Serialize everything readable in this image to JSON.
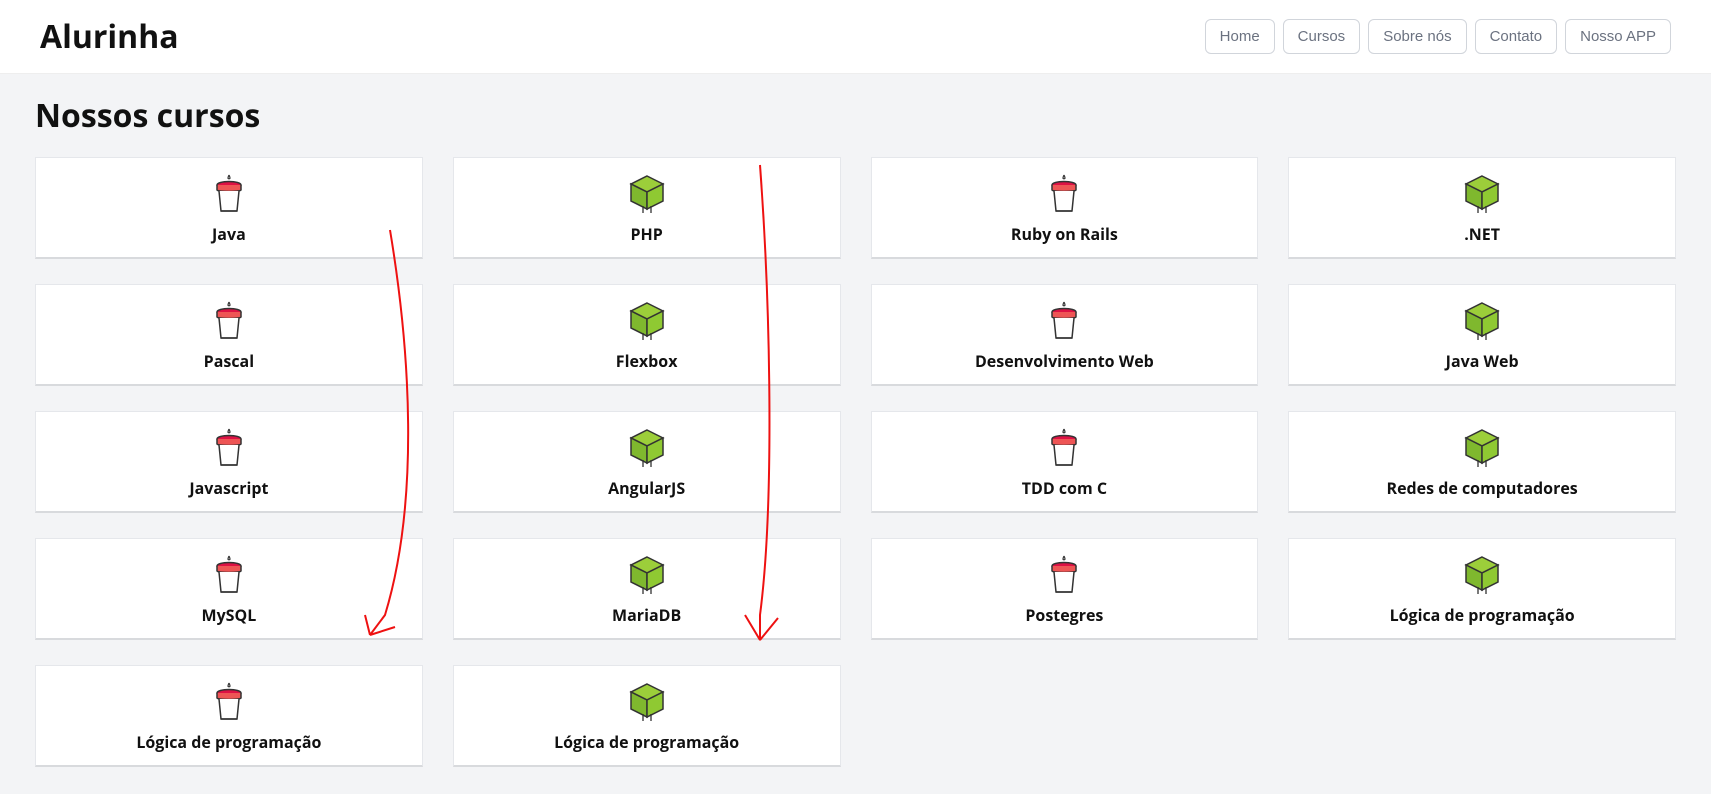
{
  "header": {
    "logo": "Alurinha",
    "nav": {
      "home": "Home",
      "cursos": "Cursos",
      "sobre": "Sobre nós",
      "contato": "Contato",
      "app": "Nosso APP"
    }
  },
  "main": {
    "section_title": "Nossos cursos",
    "courses": [
      {
        "label": "Java",
        "icon": "cup"
      },
      {
        "label": "PHP",
        "icon": "cube"
      },
      {
        "label": "Ruby on Rails",
        "icon": "cup"
      },
      {
        "label": ".NET",
        "icon": "cube"
      },
      {
        "label": "Pascal",
        "icon": "cup"
      },
      {
        "label": "Flexbox",
        "icon": "cube"
      },
      {
        "label": "Desenvolvimento Web",
        "icon": "cup"
      },
      {
        "label": "Java Web",
        "icon": "cube"
      },
      {
        "label": "Javascript",
        "icon": "cup"
      },
      {
        "label": "AngularJS",
        "icon": "cube"
      },
      {
        "label": "TDD com C",
        "icon": "cup"
      },
      {
        "label": "Redes de computadores",
        "icon": "cube"
      },
      {
        "label": "MySQL",
        "icon": "cup"
      },
      {
        "label": "MariaDB",
        "icon": "cube"
      },
      {
        "label": "Postegres",
        "icon": "cup"
      },
      {
        "label": "Lógica de programação",
        "icon": "cube"
      },
      {
        "label": "Lógica de programação",
        "icon": "cup"
      },
      {
        "label": "Lógica de programação",
        "icon": "cube"
      }
    ]
  }
}
